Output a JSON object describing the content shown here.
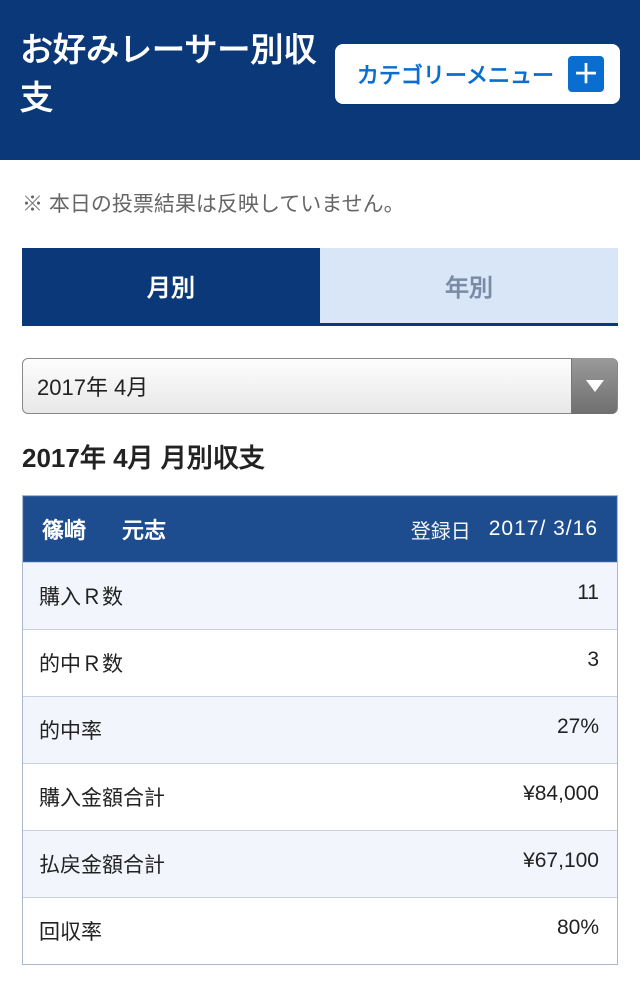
{
  "header": {
    "title": "お好みレーサー別収支",
    "category_button": "カテゴリーメニュー"
  },
  "notice": "※ 本日の投票結果は反映していません。",
  "tabs": {
    "monthly": "月別",
    "yearly": "年別"
  },
  "period_select": {
    "value": "2017年 4月"
  },
  "section_title": "2017年 4月 月別収支",
  "racer": {
    "last_name": "篠崎",
    "first_name": "元志",
    "reg_label": "登録日",
    "reg_date": "2017/ 3/16"
  },
  "rows": [
    {
      "label": "購入Ｒ数",
      "value": "11"
    },
    {
      "label": "的中Ｒ数",
      "value": "3"
    },
    {
      "label": "的中率",
      "value": "27%"
    },
    {
      "label": "購入金額合計",
      "value": "¥84,000"
    },
    {
      "label": "払戻金額合計",
      "value": "¥67,100"
    },
    {
      "label": "回収率",
      "value": "80%"
    }
  ]
}
